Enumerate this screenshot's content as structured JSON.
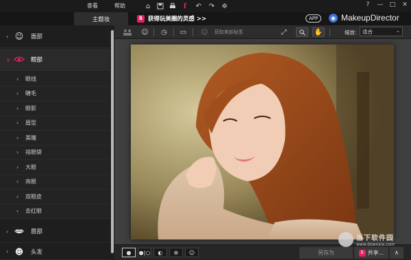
{
  "titlebar": {
    "menu": [
      "查看",
      "帮助"
    ],
    "window_controls": [
      "?",
      "—",
      "□",
      "✕"
    ]
  },
  "tabbar": {
    "active_tab": "主题妆",
    "banner_text": "获得玩美圈的灵感 >>",
    "app_badge": "APP",
    "brand": "MakeupDirector"
  },
  "sidebar": {
    "sections": [
      {
        "label": "面部",
        "icon": "face-icon",
        "expanded": false
      },
      {
        "label": "眼部",
        "icon": "eye-icon",
        "expanded": true
      }
    ],
    "eye_items": [
      "眼线",
      "睫毛",
      "眼影",
      "眉型",
      "美瞳",
      "祛眼袋",
      "大眼",
      "亮眼",
      "双眼皮",
      "去红眼"
    ],
    "bottom_sections": [
      {
        "label": "唇部",
        "icon": "lips-icon"
      },
      {
        "label": "头发",
        "icon": "hair-icon"
      }
    ]
  },
  "toolbar": {
    "get_beauty_tips": "获取美颜秘笈",
    "zoom_label": "缩放:",
    "zoom_value": "适合"
  },
  "bottombar": {
    "save_as": "另存为",
    "share": "共享..."
  },
  "watermark": {
    "name": "当下软件园",
    "url": "www.downxia.com"
  },
  "colors": {
    "accent": "#e0245e",
    "brand_blue": "#3b73d9"
  }
}
